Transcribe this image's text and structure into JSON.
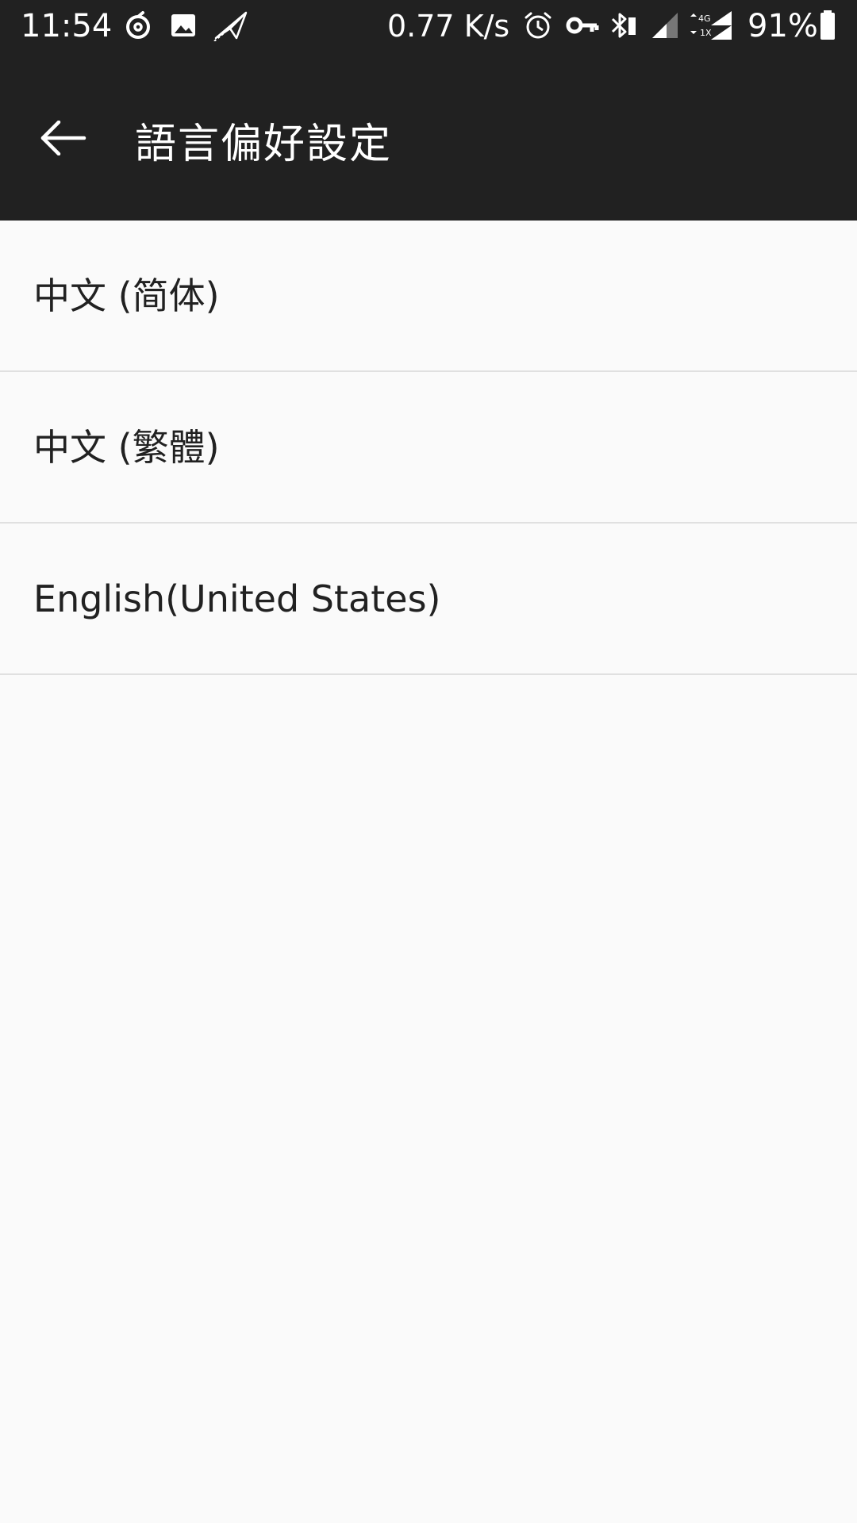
{
  "status_bar": {
    "time": "11:54",
    "network_speed": "0.77 K/s",
    "battery_percent": "91%",
    "network_type": "4G",
    "network_sub": "1X",
    "icons": [
      "netease-music-icon",
      "image-icon",
      "paper-plane-icon",
      "alarm-icon",
      "vpn-key-icon",
      "bluetooth-icon",
      "signal-icon",
      "signal-4g-icon",
      "battery-icon"
    ]
  },
  "app_bar": {
    "title": "語言偏好設定",
    "back_icon": "arrow-left-icon"
  },
  "languages": [
    {
      "label": "中文 (简体)"
    },
    {
      "label": "中文 (繁體)"
    },
    {
      "label": "English(United States)"
    }
  ],
  "colors": {
    "bar_background": "#212121",
    "page_background": "#fafafa",
    "divider": "#e0e0e0",
    "text_primary": "#212121"
  }
}
